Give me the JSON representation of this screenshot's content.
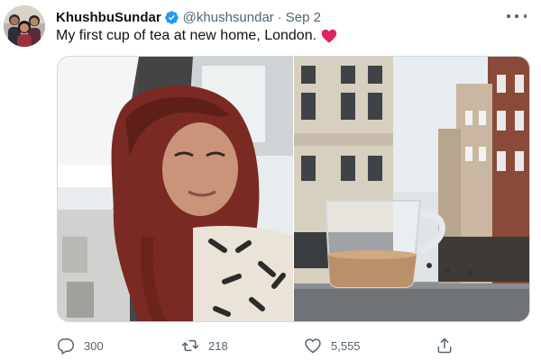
{
  "tweet": {
    "display_name": "KhushbuSundar",
    "handle": "@khushsundar",
    "separator": "·",
    "date": "Sep 2",
    "text": "My first cup of tea at new home, London.",
    "verified": true
  },
  "media": [
    {
      "description": "selfie",
      "icon": "photo"
    },
    {
      "description": "cup of tea on window sill",
      "icon": "photo"
    }
  ],
  "actions": {
    "reply_count": "300",
    "retweet_count": "218",
    "like_count": "5,555"
  },
  "colors": {
    "text_primary": "#0f1419",
    "text_secondary": "#536471",
    "verified_blue": "#1d9bf0",
    "heart_red": "#e0245e",
    "border": "#cfd9de"
  }
}
